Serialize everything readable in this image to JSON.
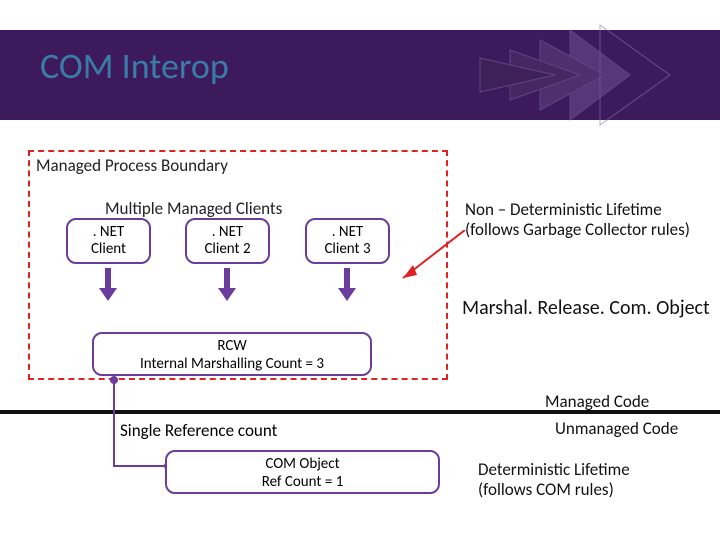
{
  "title": "COM Interop",
  "process_boundary_label": "Managed Process Boundary",
  "clients_group_label": "Multiple Managed Clients",
  "clients": {
    "c1": {
      "line1": ". NET",
      "line2": "Client"
    },
    "c2": {
      "line1": ". NET",
      "line2": "Client 2"
    },
    "c3": {
      "line1": ". NET",
      "line2": "Client 3"
    }
  },
  "rcw": {
    "line1": "RCW",
    "line2": "Internal Marshalling Count = 3"
  },
  "right": {
    "nondet_line1": "Non – Deterministic Lifetime",
    "nondet_line2": "(follows Garbage Collector rules)",
    "marshal": "Marshal. Release. Com. Object",
    "managed": "Managed Code",
    "unmanaged": "Unmanaged Code",
    "det_line1": "Deterministic Lifetime",
    "det_line2": "(follows COM rules)"
  },
  "single_ref": "Single Reference count",
  "com_box": {
    "line1": "COM Object",
    "line2": "Ref Count = 1"
  },
  "colors": {
    "band": "#3d1a5b",
    "title": "#3a7ca8",
    "boundary": "#d22",
    "box_border": "#6a3c9b"
  }
}
